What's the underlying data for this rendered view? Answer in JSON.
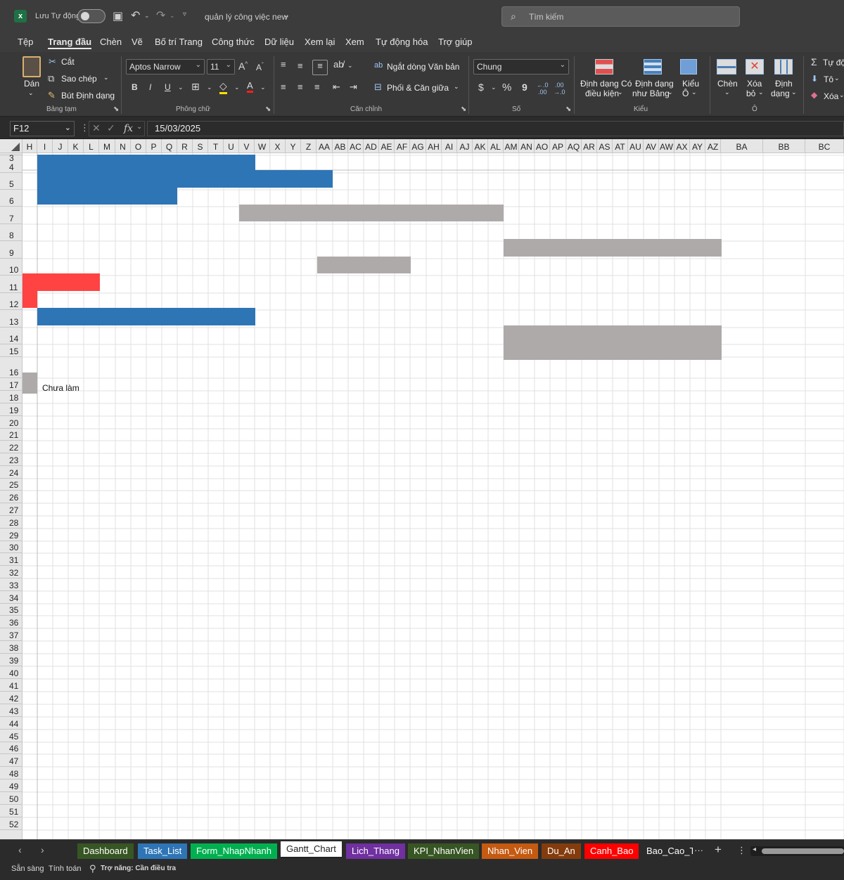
{
  "titlebar": {
    "autosave_label": "Lưu Tự động",
    "document_title": "quản lý công việc new",
    "search_placeholder": "Tìm kiếm"
  },
  "menu": [
    {
      "label": "Tệp"
    },
    {
      "label": "Trang đầu",
      "active": true
    },
    {
      "label": "Chèn"
    },
    {
      "label": "Vẽ"
    },
    {
      "label": "Bố trí Trang"
    },
    {
      "label": "Công thức"
    },
    {
      "label": "Dữ liệu"
    },
    {
      "label": "Xem lại"
    },
    {
      "label": "Xem"
    },
    {
      "label": "Tự động hóa"
    },
    {
      "label": "Trợ giúp"
    }
  ],
  "ribbon": {
    "clipboard": {
      "paste": "Dán",
      "cut": "Cắt",
      "copy": "Sao chép",
      "format_painter": "Bút Định dạng",
      "group": "Bảng tạm"
    },
    "font": {
      "name": "Aptos Narrow",
      "size": "11",
      "bold": "B",
      "italic": "I",
      "underline": "U",
      "group": "Phông chữ"
    },
    "alignment": {
      "wrap_text": "Ngắt dòng Văn bản",
      "merge_center": "Phối & Căn giữa",
      "group": "Căn chỉnh"
    },
    "number": {
      "format": "Chung",
      "currency": "$",
      "percent": "%",
      "comma": "9",
      "group": "Số"
    },
    "styles": {
      "conditional_line1": "Định dạng Có",
      "conditional_line2": "điều kiện",
      "table_line1": "Định dạng",
      "table_line2": "như Bảng",
      "cell_line1": "Kiểu",
      "cell_line2": "Ô",
      "group": "Kiểu"
    },
    "cells": {
      "insert": "Chèn",
      "delete_line1": "Xóa",
      "delete_line2": "bỏ",
      "format_line1": "Định",
      "format_line2": "dạng",
      "group": "Ô"
    },
    "editing": {
      "autosum": "Tự độ",
      "fill": "Tô",
      "clear": "Xóa"
    }
  },
  "formula_bar": {
    "name_box": "F12",
    "fx": "fx",
    "value": "15/03/2025"
  },
  "grid": {
    "columns": [
      "H",
      "I",
      "J",
      "K",
      "L",
      "M",
      "N",
      "O",
      "P",
      "Q",
      "R",
      "S",
      "T",
      "U",
      "V",
      "W",
      "X",
      "Y",
      "Z",
      "AA",
      "AB",
      "AC",
      "AD",
      "AE",
      "AF",
      "AG",
      "AH",
      "AI",
      "AJ",
      "AK",
      "AL",
      "AM",
      "AN",
      "AO",
      "AP",
      "AQ",
      "AR",
      "AS",
      "AT",
      "AU",
      "AV",
      "AW",
      "AX",
      "AY",
      "AZ",
      "BA",
      "BB",
      "BC"
    ],
    "rows": [
      "3",
      "4",
      "5",
      "6",
      "7",
      "8",
      "9",
      "10",
      "11",
      "12",
      "13",
      "14",
      "15",
      "16",
      "17",
      "18",
      "19",
      "20",
      "21",
      "22",
      "23",
      "24",
      "25",
      "26",
      "27",
      "28",
      "29",
      "30",
      "31",
      "32",
      "33",
      "34",
      "35",
      "36",
      "37",
      "38",
      "39",
      "40",
      "41",
      "42",
      "43",
      "44",
      "45",
      "46",
      "47",
      "48",
      "49",
      "50",
      "51",
      "52"
    ],
    "legend_label": "Chưa làm",
    "colors": {
      "in_progress": "#2e75b6",
      "not_started": "#aeaaaa",
      "overdue": "#ff4343"
    }
  },
  "sheet_tabs": [
    {
      "label": "Dashboard",
      "color": "#375623"
    },
    {
      "label": "Task_List",
      "color": "#2e75b6"
    },
    {
      "label": "Form_NhapNhanh",
      "color": "#00b050"
    },
    {
      "label": "Gantt_Chart",
      "active": true
    },
    {
      "label": "Lich_Thang",
      "color": "#7030a0"
    },
    {
      "label": "KPI_NhanVien",
      "color": "#375623"
    },
    {
      "label": "Nhan_Vien",
      "color": "#c55a11"
    },
    {
      "label": "Du_An",
      "color": "#843c0c"
    },
    {
      "label": "Canh_Bao",
      "color": "#ff0000"
    },
    {
      "label": "Bao_Cao_T"
    }
  ],
  "status": {
    "ready": "Sẵn sàng",
    "calculate": "Tính toán",
    "accessibility": "Trợ năng: Cần điều tra"
  }
}
